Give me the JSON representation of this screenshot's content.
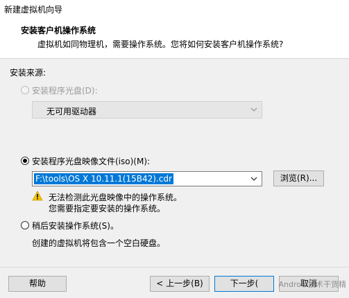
{
  "window": {
    "title": "新建虚拟机向导"
  },
  "header": {
    "title": "安装客户机操作系统",
    "subtitle": "虚拟机如同物理机，需要操作系统。您将如何安装客户机操作系统?"
  },
  "source": {
    "group_label": "安装来源:",
    "disc_option": {
      "label": "安装程序光盘(D):",
      "enabled": false,
      "selected": false
    },
    "disc_combo": {
      "value": "无可用驱动器",
      "enabled": false
    },
    "iso_option": {
      "label": "安装程序光盘映像文件(iso)(M):",
      "selected": true
    },
    "iso_path": "F:\\tools\\OS X 10.11.1(15B42).cdr",
    "browse_button": "浏览(R)...",
    "warning_line1": "无法检测此光盘映像中的操作系统。",
    "warning_line2": "您需要指定要安装的操作系统。",
    "later_option": {
      "label": "稍后安装操作系统(S)。",
      "selected": false
    },
    "later_desc": "创建的虚拟机将包含一个空白硬盘。"
  },
  "footer": {
    "help_button": "帮助",
    "back_button": "< 上一步(B)",
    "next_button": "下一步(",
    "cancel_button": "取消"
  },
  "watermark": "Android技术干货精",
  "colors": {
    "selection": "#0078d7",
    "warning": "#f5c400"
  }
}
